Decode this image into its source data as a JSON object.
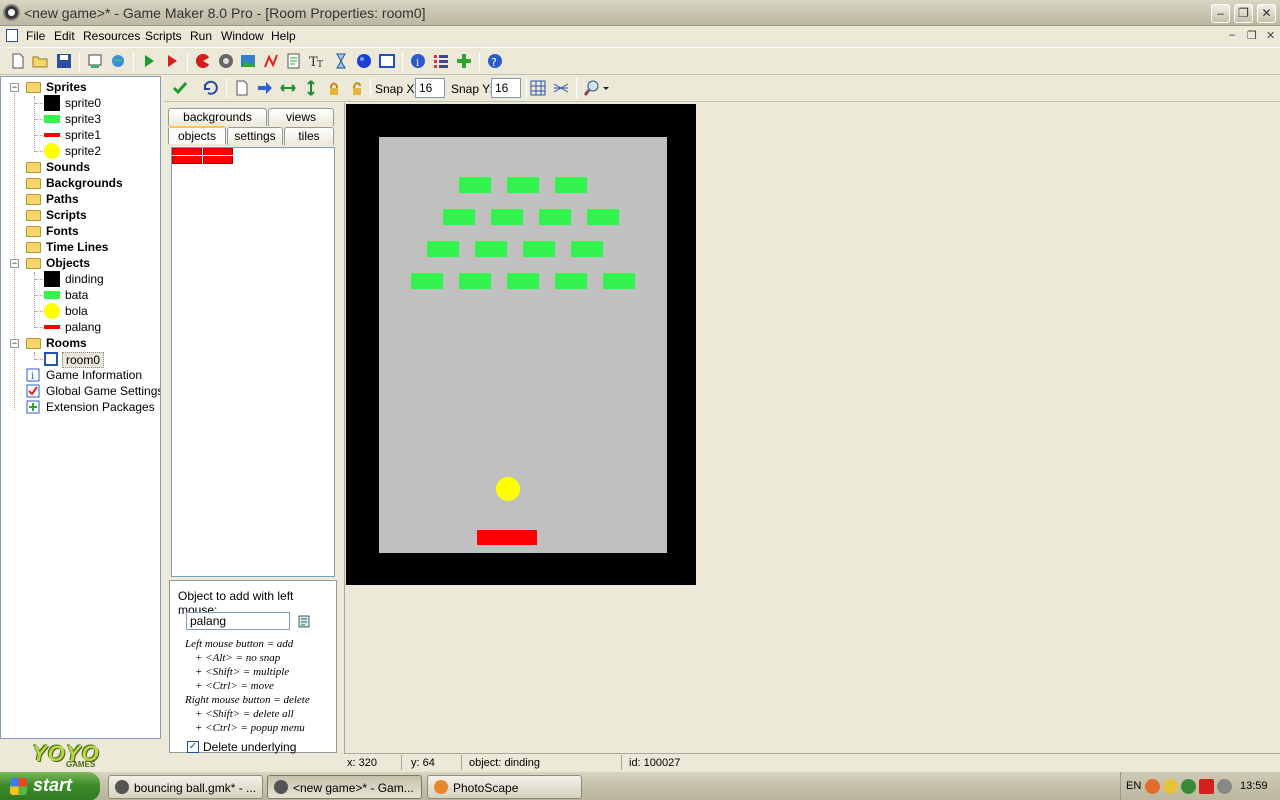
{
  "window": {
    "title": "<new game>* - Game Maker 8.0 Pro - [Room Properties: room0]",
    "min": "–",
    "restore": "❐",
    "close": "✕"
  },
  "menu": [
    "File",
    "Edit",
    "Resources",
    "Scripts",
    "Run",
    "Window",
    "Help"
  ],
  "mdi": {
    "min": "–",
    "restore": "❐",
    "close": "✕"
  },
  "tree": {
    "sprites": "Sprites",
    "sprite_items": [
      {
        "label": "sprite0",
        "color": "#000000",
        "shape": "square"
      },
      {
        "label": "sprite3",
        "color": "#33f34d",
        "shape": "bar"
      },
      {
        "label": "sprite1",
        "color": "#ff0000",
        "shape": "thin"
      },
      {
        "label": "sprite2",
        "color": "#ffff00",
        "shape": "circle"
      }
    ],
    "sounds": "Sounds",
    "backgrounds": "Backgrounds",
    "paths": "Paths",
    "scripts": "Scripts",
    "fonts": "Fonts",
    "timelines": "Time Lines",
    "objects": "Objects",
    "object_items": [
      {
        "label": "dinding",
        "color": "#000000",
        "shape": "square"
      },
      {
        "label": "bata",
        "color": "#33f34d",
        "shape": "bar"
      },
      {
        "label": "bola",
        "color": "#ffff00",
        "shape": "circle"
      },
      {
        "label": "palang",
        "color": "#ff0000",
        "shape": "thin"
      }
    ],
    "rooms": "Rooms",
    "room_items": [
      "room0"
    ],
    "game_info": "Game Information",
    "global_settings": "Global Game Settings",
    "extensions": "Extension Packages",
    "expand_minus": "−"
  },
  "logo": {
    "text": "YOYO",
    "sub": "GAMES"
  },
  "toolbar2": {
    "snap_x_label": "Snap X:",
    "snap_x": "16",
    "snap_y_label": "Snap Y:",
    "snap_y": "16"
  },
  "tabs": {
    "backgrounds": "backgrounds",
    "views": "views",
    "objects": "objects",
    "settings": "settings",
    "tiles": "tiles"
  },
  "panel": {
    "add_label": "Object to add with left mouse:",
    "selected_object": "palang",
    "help": [
      "Left mouse button = add",
      "+ <Alt> = no snap",
      "+ <Shift> = multiple",
      "+ <Ctrl> = move",
      "Right mouse button = delete",
      "+ <Shift> = delete all",
      "+ <Ctrl> = popup menu"
    ],
    "delete_underlying": "Delete underlying",
    "delete_checked": "✓"
  },
  "status": {
    "x": "x: 320",
    "y": "y: 64",
    "object": "object: dinding",
    "id": "id: 100027"
  },
  "taskbar": {
    "start": "start",
    "tasks": [
      "bouncing ball.gmk* - ...",
      "<new game>* - Gam...",
      "PhotoScape"
    ],
    "lang": "EN",
    "clock": "13:59"
  },
  "colors": {
    "wall": "#000000",
    "floor": "#c0c0c0",
    "brick": "#33f34d",
    "ball": "#ffff00",
    "paddle": "#ff0000"
  }
}
